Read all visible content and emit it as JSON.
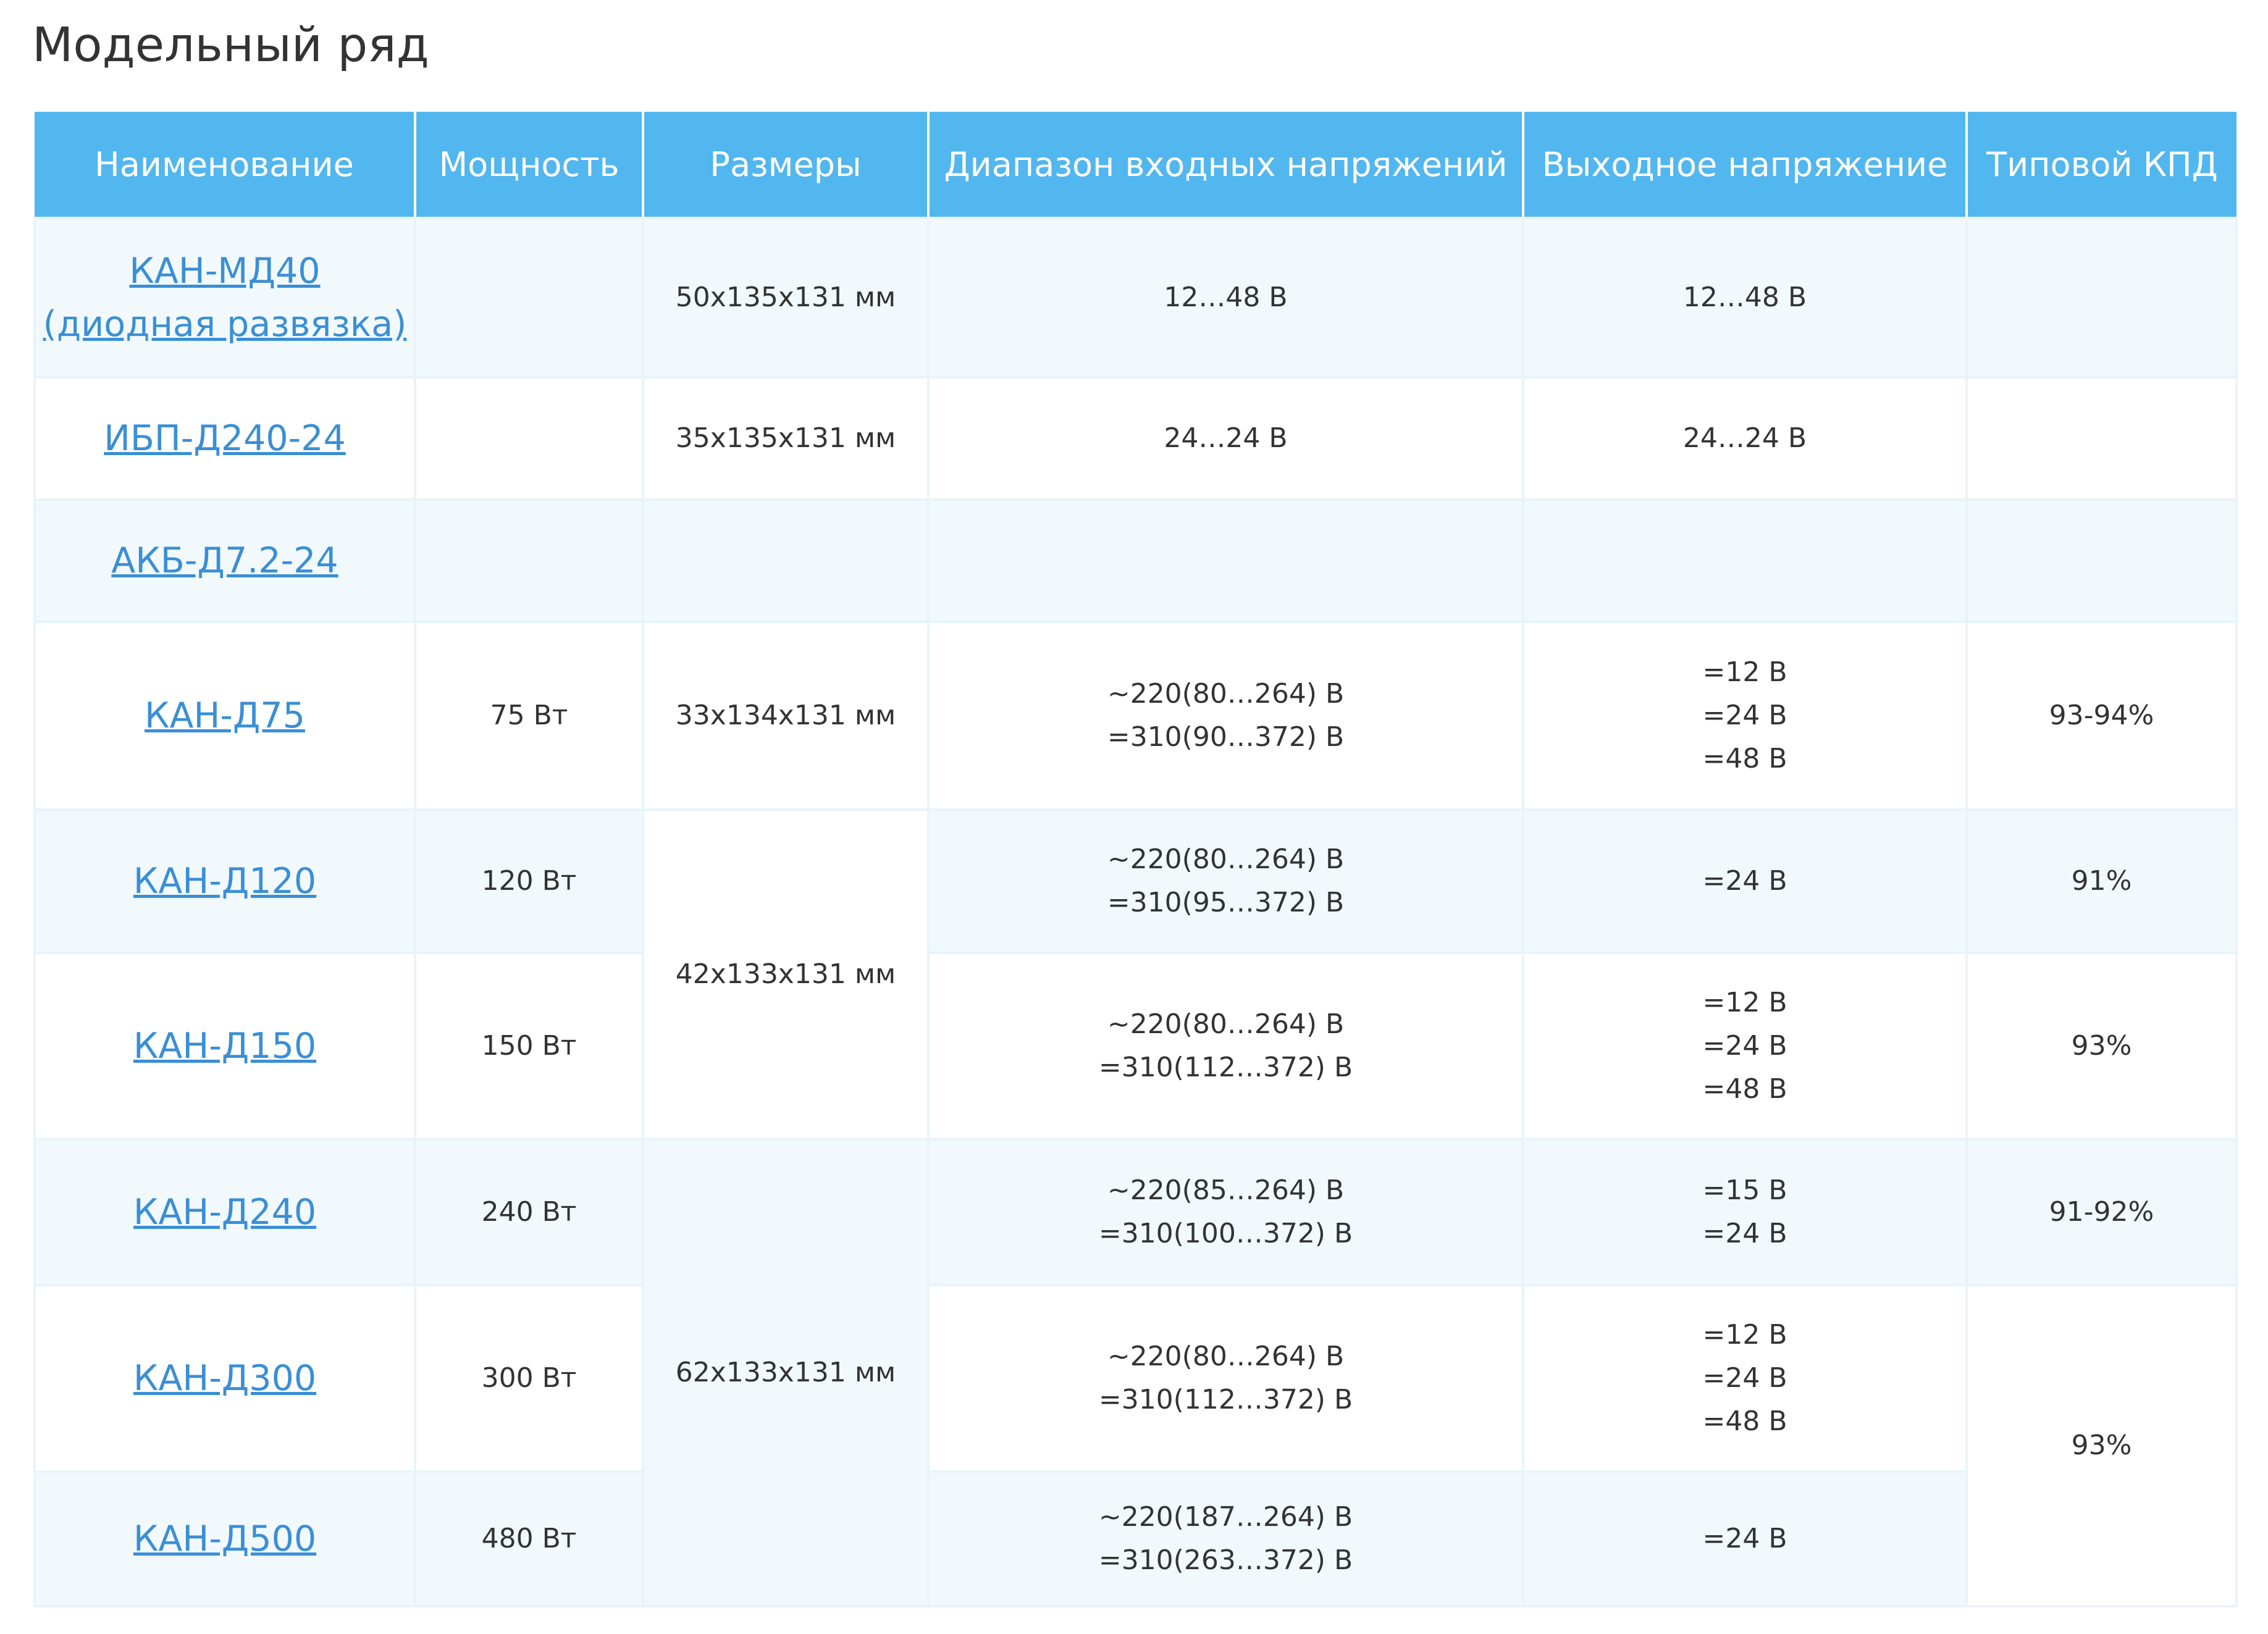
{
  "page": {
    "title": "Модельный ряд"
  },
  "colors": {
    "header_bg": "#52b6ef",
    "header_text": "#ffffff",
    "row_alt_bg": "#f2f9fd",
    "link": "#3a8fd5",
    "text": "#333333"
  },
  "table": {
    "headers": [
      "Наименование",
      "Мощность",
      "Размеры",
      "Диапазон входных напряжений",
      "Выходное напряжение",
      "Типовой КПД"
    ],
    "rows": [
      {
        "name_lines": [
          "КАН-МД40",
          "(диодная развязка)"
        ],
        "power": "",
        "size": "50х135х131 мм",
        "input": [
          "12…48 В"
        ],
        "output": [
          "12…48 В"
        ],
        "efficiency": ""
      },
      {
        "name_lines": [
          "ИБП-Д240-24"
        ],
        "power": "",
        "size": "35х135х131 мм",
        "input": [
          "24…24 В"
        ],
        "output": [
          "24…24 В"
        ],
        "efficiency": ""
      },
      {
        "name_lines": [
          "АКБ-Д7.2-24"
        ],
        "power": "",
        "size": "",
        "input": [],
        "output": [],
        "efficiency": ""
      },
      {
        "name_lines": [
          "КАН-Д75"
        ],
        "power": "75 Вт",
        "size": "33х134х131 мм",
        "input": [
          "~220(80…264) В",
          "=310(90…372) В"
        ],
        "output": [
          "=12 В",
          "=24 В",
          "=48 В"
        ],
        "efficiency": "93-94%"
      },
      {
        "name_lines": [
          "КАН-Д120"
        ],
        "power": "120 Вт",
        "size": "42х133х131 мм",
        "input": [
          "~220(80…264) В",
          "=310(95…372) В"
        ],
        "output": [
          "=24 В"
        ],
        "efficiency": "91%"
      },
      {
        "name_lines": [
          "КАН-Д150"
        ],
        "power": "150 Вт",
        "size": "",
        "input": [
          "~220(80…264) В",
          "=310(112…372) В"
        ],
        "output": [
          "=12 В",
          "=24 В",
          "=48 В"
        ],
        "efficiency": "93%"
      },
      {
        "name_lines": [
          "КАН-Д240"
        ],
        "power": "240 Вт",
        "size": "62х133х131 мм",
        "input": [
          "~220(85…264) В",
          "=310(100…372) В"
        ],
        "output": [
          "=15 В",
          "=24 В"
        ],
        "efficiency": "91-92%"
      },
      {
        "name_lines": [
          "КАН-Д300"
        ],
        "power": "300 Вт",
        "size": "",
        "input": [
          "~220(80…264) В",
          "=310(112…372) В"
        ],
        "output": [
          "=12 В",
          "=24 В",
          "=48 В"
        ],
        "efficiency": "93%"
      },
      {
        "name_lines": [
          "КАН-Д500"
        ],
        "power": "480 Вт",
        "size": "",
        "input": [
          "~220(187…264) В",
          "=310(263…372) В"
        ],
        "output": [
          "=24 В"
        ],
        "efficiency": ""
      }
    ]
  }
}
